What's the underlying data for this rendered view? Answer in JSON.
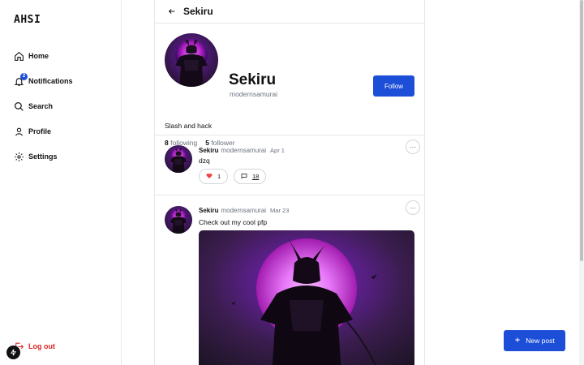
{
  "app": {
    "logo": "AHSI"
  },
  "sidebar": {
    "items": [
      {
        "label": "Home",
        "icon": "home-icon"
      },
      {
        "label": "Notifications",
        "icon": "bell-icon",
        "badge": "2"
      },
      {
        "label": "Search",
        "icon": "search-icon"
      },
      {
        "label": "Profile",
        "icon": "user-icon"
      },
      {
        "label": "Settings",
        "icon": "gear-icon"
      }
    ],
    "logout": {
      "label": "Log out",
      "icon": "logout-icon"
    }
  },
  "topbar": {
    "title": "Sekiru"
  },
  "profile": {
    "name": "Sekiru",
    "handle": "modernsamurai",
    "follow_label": "Follow",
    "bio": "Slash and hack",
    "following_count": "8",
    "following_label": "following",
    "follower_count": "5",
    "follower_label": "follower"
  },
  "posts": [
    {
      "author": "Sekiru",
      "handle": "modernsamurai",
      "date": "Apr 1",
      "text": "dzq",
      "likes": "1",
      "comments": "18",
      "more_label": "···"
    },
    {
      "author": "Sekiru",
      "handle": "modernsamurai",
      "date": "Mar 23",
      "text": "Check out my cool pfp",
      "more_label": "···"
    }
  ],
  "new_post": {
    "label": "New post"
  },
  "colors": {
    "accent": "#1d4ed8",
    "danger": "#dc2626",
    "like": "#ef4444"
  }
}
